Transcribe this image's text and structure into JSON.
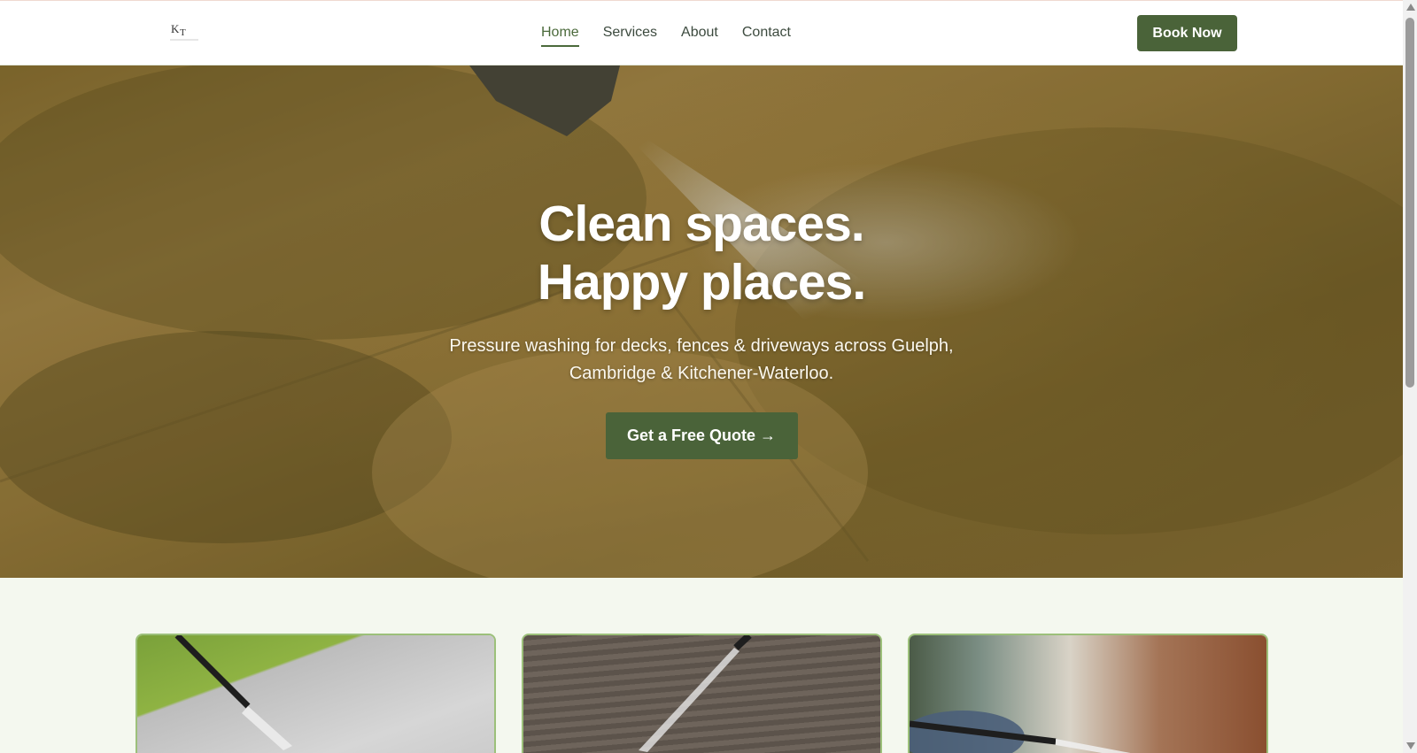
{
  "header": {
    "logo_text": "KT",
    "nav": [
      {
        "label": "Home",
        "active": true
      },
      {
        "label": "Services",
        "active": false
      },
      {
        "label": "About",
        "active": false
      },
      {
        "label": "Contact",
        "active": false
      }
    ],
    "book_label": "Book Now"
  },
  "hero": {
    "title_line1": "Clean spaces.",
    "title_line2": "Happy places.",
    "subtitle_line1": "Pressure washing for decks, fences & driveways across Guelph,",
    "subtitle_line2": "Cambridge & Kitchener-Waterloo.",
    "cta_label": "Get a Free Quote →"
  },
  "cards": [
    {
      "image": "pressure-washing-patio-image"
    },
    {
      "image": "pressure-washing-deck-image"
    },
    {
      "image": "pressure-washing-fence-image"
    }
  ],
  "colors": {
    "brand_green": "#4a6339",
    "page_background": "#f4f8ef",
    "card_border": "#9cc07a"
  }
}
